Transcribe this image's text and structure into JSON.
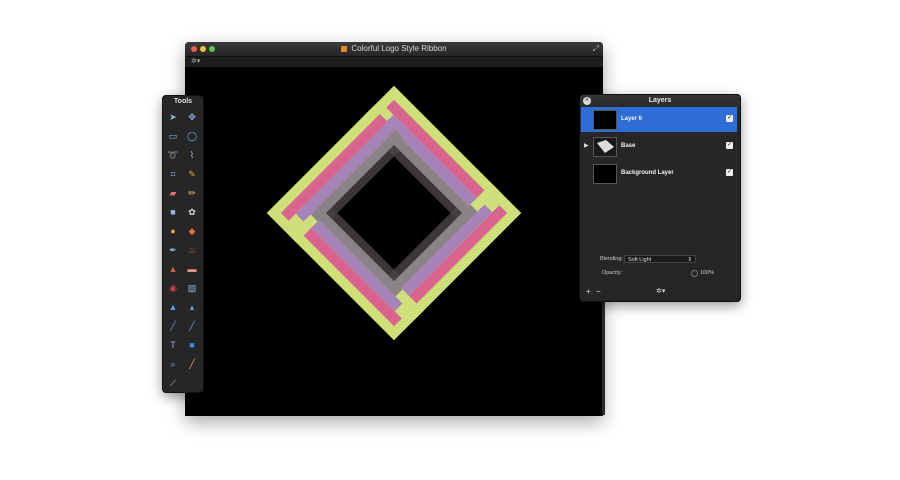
{
  "document_window": {
    "title": "Colorful Logo Style Ribbon",
    "fullscreen_icon": "fullscreen-arrows-icon",
    "toolbar_icon": "gear-icon"
  },
  "artwork": {
    "colors": {
      "lime": "#cfe07a",
      "pink": "#d9578f",
      "purple": "#8e6fb3",
      "gray": "#8a8287"
    }
  },
  "tools_panel": {
    "title": "Tools",
    "tools": [
      "pointer-icon",
      "move-icon",
      "rect-select-icon",
      "ellipse-select-icon",
      "lasso-icon",
      "polygon-lasso-icon",
      "crop-icon",
      "eyedropper-icon",
      "eraser-icon",
      "pencil-icon",
      "rectangle-icon",
      "clone-icon",
      "smudge-icon",
      "paint-bucket-icon",
      "paint-brush-icon",
      "burn-icon",
      "stamp-icon",
      "bandage-icon",
      "red-eye-icon",
      "sponge-icon",
      "sharpen-icon",
      "blur-icon",
      "pen-icon",
      "line-icon",
      "text-icon",
      "shape-icon",
      "zoom-icon",
      "color-picker-icon",
      "brush-stroke-icon"
    ]
  },
  "layers_panel": {
    "title": "Layers",
    "layers": [
      {
        "name": "Layer 6",
        "visible": true,
        "selected": true
      },
      {
        "name": "Base",
        "visible": true,
        "selected": false
      },
      {
        "name": "Background Layer",
        "visible": true,
        "selected": false
      }
    ],
    "blending_label": "Blending:",
    "blending_value": "Soft Light",
    "opacity_label": "Opacity:",
    "opacity_value": "100%",
    "footer": {
      "add": "+",
      "remove": "−",
      "settings_icon": "gear-icon"
    }
  }
}
